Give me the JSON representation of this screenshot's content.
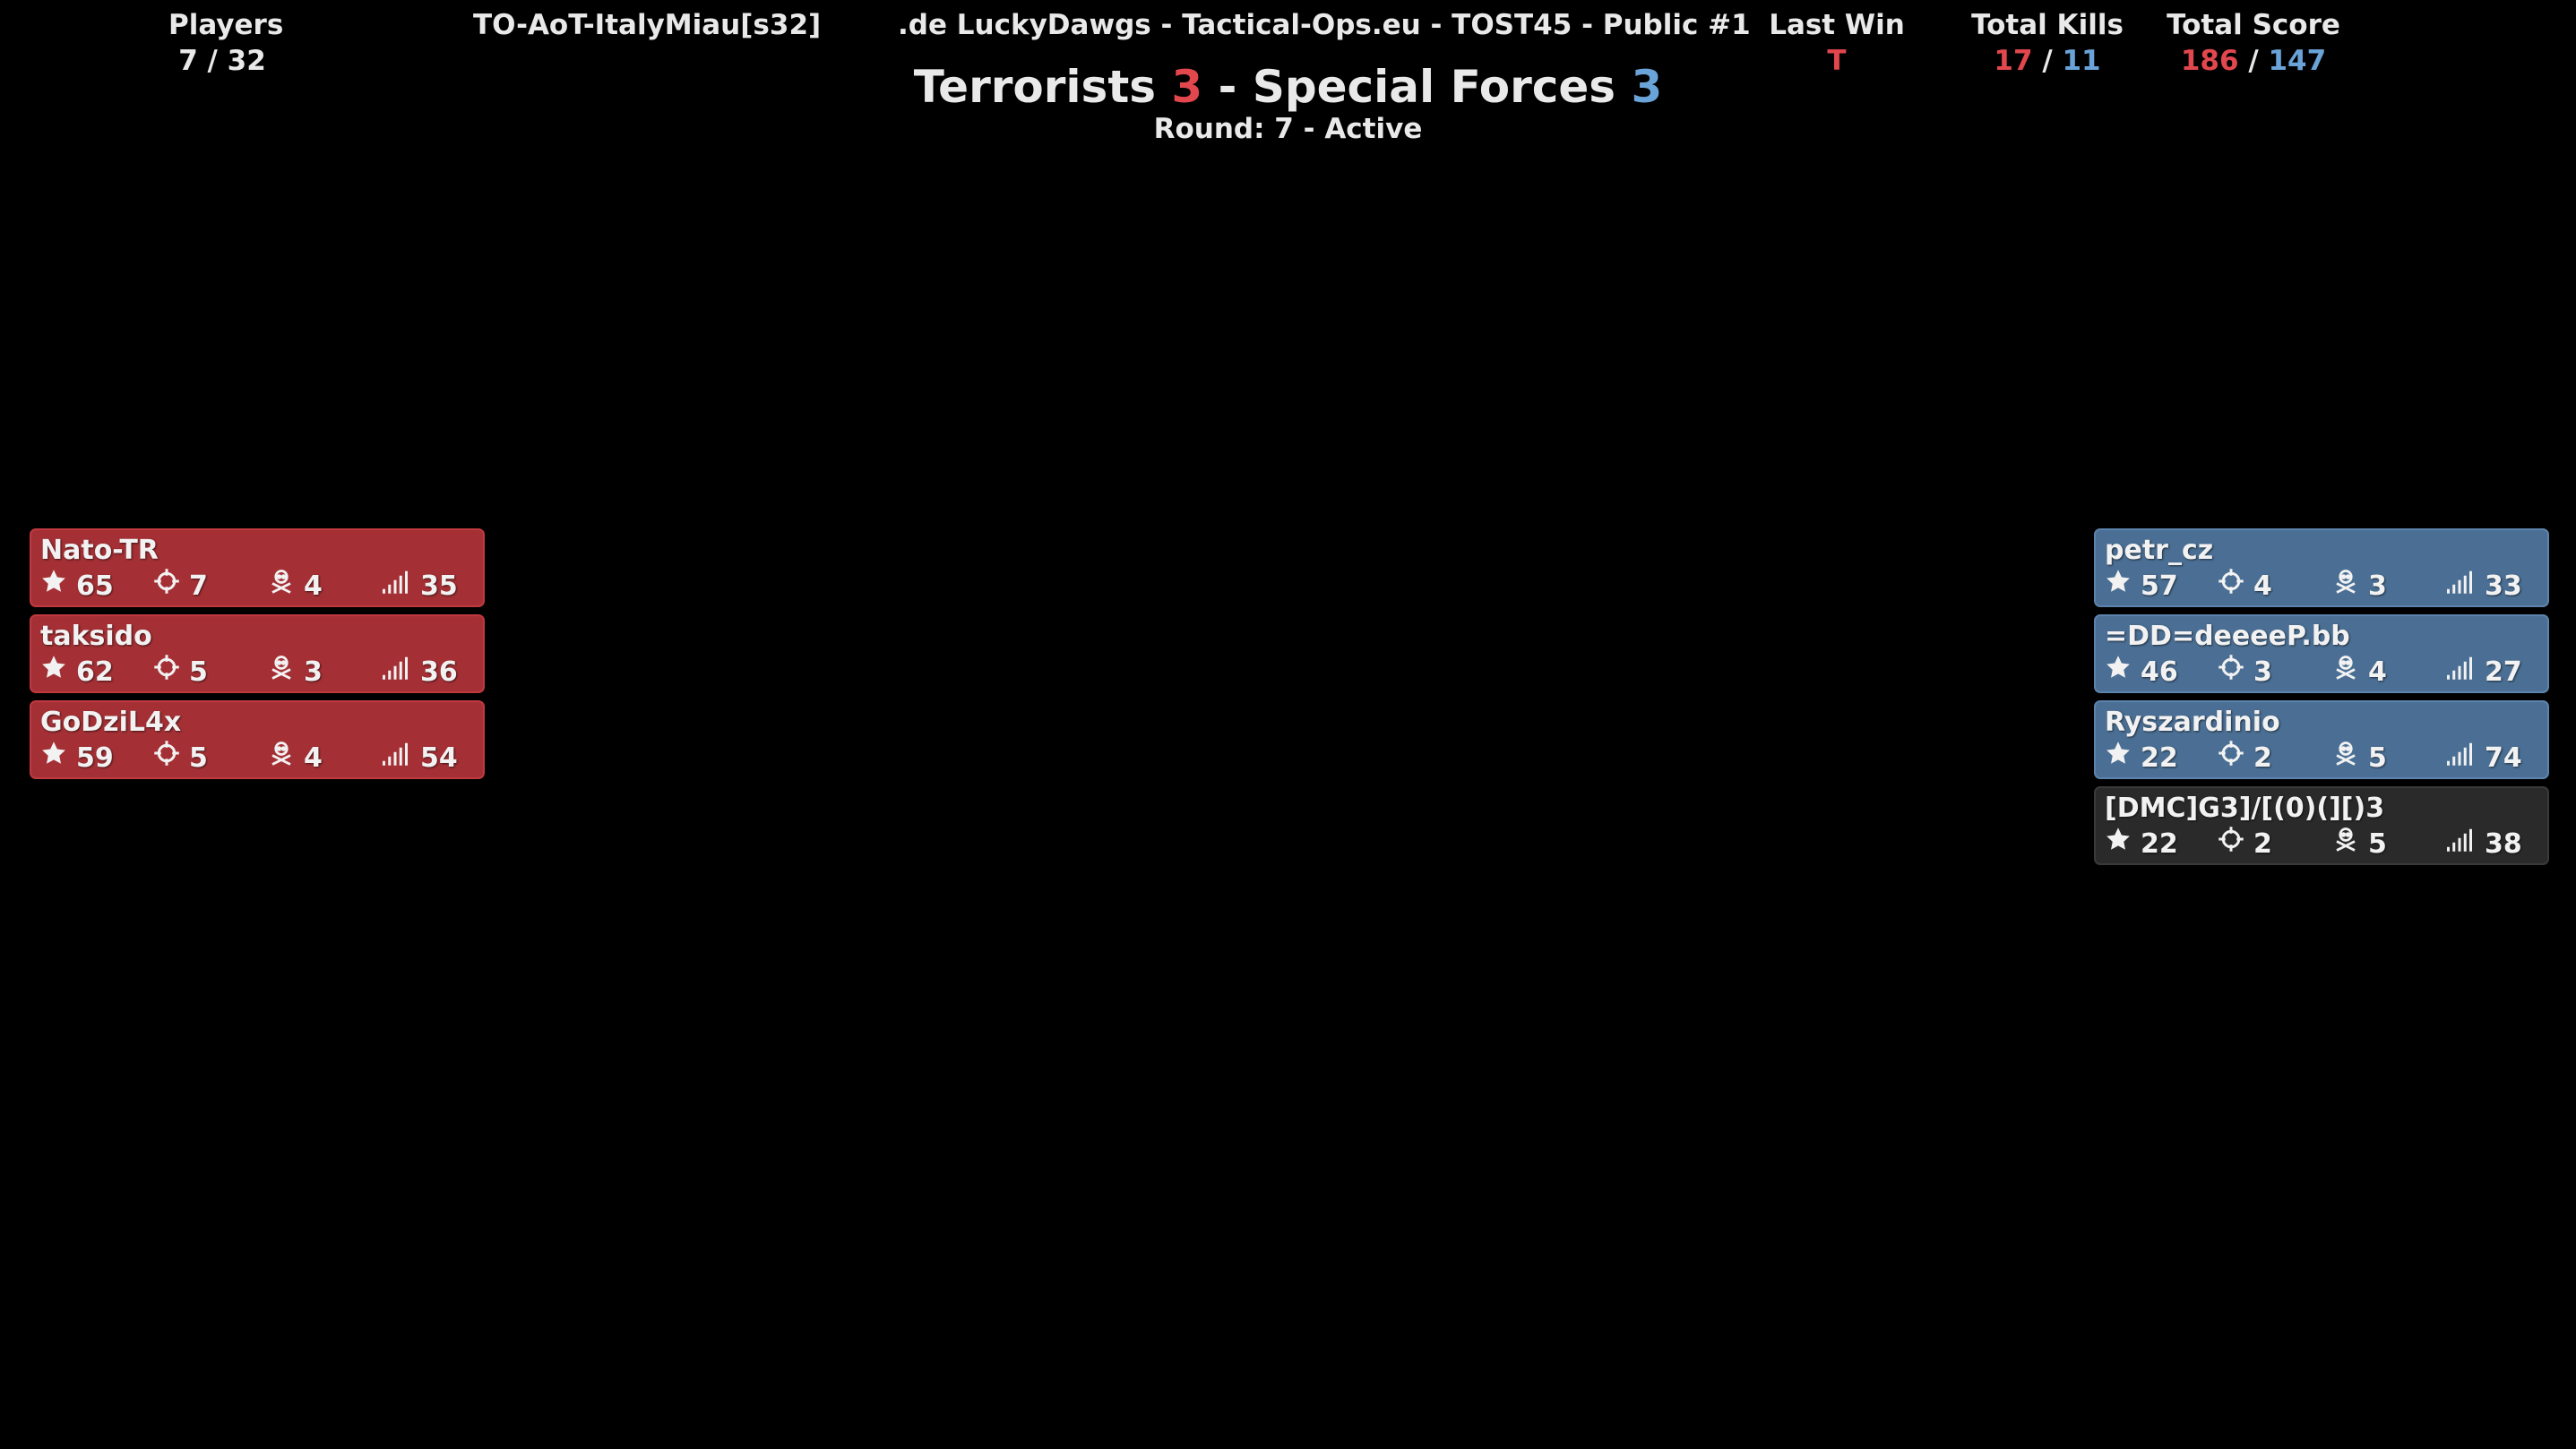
{
  "header": {
    "players_label": "Players",
    "players_value": "7 / 32",
    "map_name": "TO-AoT-ItalyMiau[s32]",
    "server_name": ".de LuckyDawgs - Tactical-Ops.eu - TOST45 - Public #1",
    "last_win_label": "Last Win",
    "last_win_value": "T",
    "total_kills_label": "Total Kills",
    "total_kills_t": "17",
    "total_kills_sf": "11",
    "total_score_label": "Total Score",
    "total_score_t": "186",
    "total_score_sf": "147",
    "separator": "/"
  },
  "scoreline": {
    "team_t": "Terrorists",
    "score_t": "3",
    "dash": "-",
    "team_sf": "Special Forces",
    "score_sf": "3",
    "round_text": "Round: 7 - Active"
  },
  "colors": {
    "terrorists": "#a43035",
    "special_forces": "#4b6f94",
    "spectator": "#2a2a2a",
    "red_text": "#e2474d",
    "blue_text": "#6aa3d8"
  },
  "icons": {
    "score": "star-icon",
    "kills": "crosshair-icon",
    "deaths": "skull-crossbones-icon",
    "ping": "signal-bars-icon"
  },
  "terrorists": [
    {
      "name": "Nato-TR",
      "score": "65",
      "kills": "7",
      "deaths": "4",
      "ping": "35"
    },
    {
      "name": "taksido",
      "score": "62",
      "kills": "5",
      "deaths": "3",
      "ping": "36"
    },
    {
      "name": "GoDziL4x",
      "score": "59",
      "kills": "5",
      "deaths": "4",
      "ping": "54"
    }
  ],
  "special_forces": [
    {
      "name": "petr_cz",
      "score": "57",
      "kills": "4",
      "deaths": "3",
      "ping": "33"
    },
    {
      "name": "=DD=deeeeP.bb",
      "score": "46",
      "kills": "3",
      "deaths": "4",
      "ping": "27"
    },
    {
      "name": "Ryszardinio",
      "score": "22",
      "kills": "2",
      "deaths": "5",
      "ping": "74"
    },
    {
      "name": "[DMC]G3]/[(0)(][)3",
      "score": "22",
      "kills": "2",
      "deaths": "5",
      "ping": "38"
    }
  ]
}
